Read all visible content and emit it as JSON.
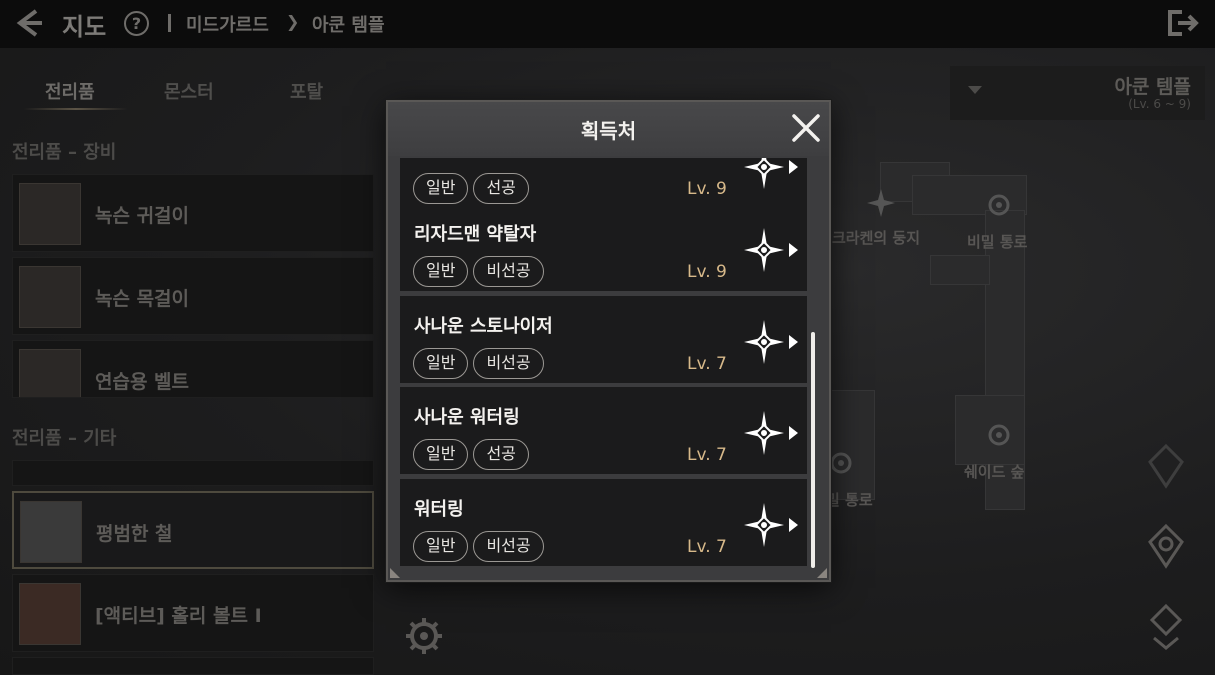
{
  "header": {
    "title": "지도",
    "help_icon": "question-circle-icon",
    "breadcrumb": [
      "미드가르드",
      "아쿤 템플"
    ]
  },
  "tabs": [
    {
      "label": "전리품",
      "active": true
    },
    {
      "label": "몬스터",
      "active": false
    },
    {
      "label": "포탈",
      "active": false
    }
  ],
  "sections": {
    "equipment_title": "전리품 – 장비",
    "misc_title": "전리품 – 기타"
  },
  "equipment_items": [
    {
      "name": "녹슨 귀걸이"
    },
    {
      "name": "녹슨 목걸이"
    },
    {
      "name": "연습용 벨트"
    }
  ],
  "misc_items": [
    {
      "name": "평범한 철",
      "selected": true
    },
    {
      "name": "[액티브] 홀리 볼트 I",
      "selected": false
    }
  ],
  "region": {
    "name": "아쿤 템플",
    "level": "(Lv. 6 ~ 9)"
  },
  "map_labels": {
    "nest": "크라켄의 둥지",
    "secret": "비밀 통로",
    "shade": "쉐이드 숲",
    "passage": "밀 통로"
  },
  "modal": {
    "title": "획득처",
    "close_icon": "close-x-icon",
    "entries": [
      {
        "name": "",
        "tags": [
          "일반",
          "선공"
        ],
        "level": "Lv. 9"
      },
      {
        "name": "리자드맨 약탈자",
        "tags": [
          "일반",
          "비선공"
        ],
        "level": "Lv. 9"
      },
      {
        "name": "사나운 스토나이저",
        "tags": [
          "일반",
          "비선공"
        ],
        "level": "Lv. 7"
      },
      {
        "name": "사나운 워터링",
        "tags": [
          "일반",
          "선공"
        ],
        "level": "Lv. 7"
      },
      {
        "name": "워터링",
        "tags": [
          "일반",
          "비선공"
        ],
        "level": "Lv. 7"
      }
    ],
    "nav_icon": "compass-star-arrow-icon"
  },
  "colors": {
    "level_text": "#d7b98a",
    "modal_bg": "#3c3c3e",
    "entry_bg": "#1b1b1c"
  }
}
